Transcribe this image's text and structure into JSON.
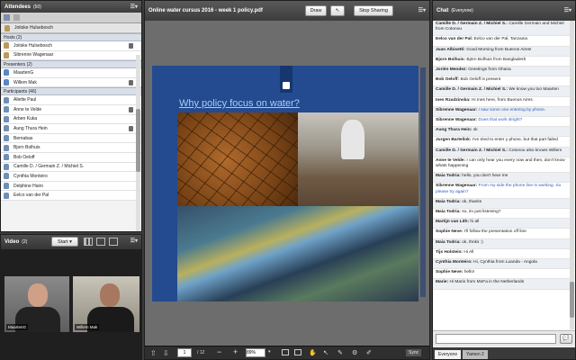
{
  "attendees": {
    "title": "Attendees",
    "count": "(50)",
    "current_user": "Joitske Hulsebosch",
    "hosts": {
      "label": "Hosts (2)",
      "items": [
        "Joitske Hulsebosch",
        "Sibrenne Wagenaar"
      ]
    },
    "presenters": {
      "label": "Presenters (2)",
      "items": [
        "MaartenG",
        "Willem Mak"
      ]
    },
    "participants": {
      "label": "Participants (46)",
      "items": [
        "Aliette Paul",
        "Anne te Velde",
        "Arben Kuka",
        "Aung Thura Hein",
        "Bernabas",
        "Bjorn Bolhuis",
        "Bob Oeloff",
        "Camille D. / Germain Z. / Michiel S.",
        "Cynthia Monteiro",
        "Delphine Hairo",
        "Eelco van der Pal"
      ]
    }
  },
  "video": {
    "title": "Video",
    "count": "(2)",
    "start_label": "Start",
    "tiles": [
      {
        "name": "MaartenG"
      },
      {
        "name": "Willem Mak"
      }
    ]
  },
  "share": {
    "title": "Online water cursus 2016 - week 1 policy.pdf",
    "draw_label": "Draw",
    "stop_label": "Stop Sharing",
    "slide_heading": "Why policy focus on water?",
    "page_value": "1",
    "page_total": "/ 12",
    "zoom_value": "89%",
    "sync_label": "Sync"
  },
  "chat": {
    "title": "Chat",
    "scope": "(Everyone)",
    "messages": [
      {
        "name": "Camille D. / Germain Z. / Michiel S.:",
        "text": "Camille Germain and Michiel from Cotonou",
        "style": "alt"
      },
      {
        "name": "Eelco van der Pal:",
        "text": "Eelco van der Pal, Tanzania",
        "style": ""
      },
      {
        "name": "Juan Albisetti:",
        "text": "Good Morning from Buenos Aires!",
        "style": "alt"
      },
      {
        "name": "Bjorn Bolhuis:",
        "text": "Björn Bolhuis from Bangladesh",
        "style": ""
      },
      {
        "name": "Jorién Mendez:",
        "text": "Greetings from Ghana",
        "style": "alt"
      },
      {
        "name": "Bob Oeloff:",
        "text": "Bob Oeloff is present",
        "style": ""
      },
      {
        "name": "Camille D. / Germain Z. / Michiel S.:",
        "text": "We know you too Maarten",
        "style": "alt"
      },
      {
        "name": "Ines Rzadzinska:",
        "text": "Hi Ines here, from Buenos Aires",
        "style": ""
      },
      {
        "name": "Sibrenne Wagenaar:",
        "text": "I saw some one entering by phone.",
        "style": "alt blue"
      },
      {
        "name": "Sibrenne Wagenaar:",
        "text": "Does that work slright?",
        "style": "blue"
      },
      {
        "name": "Aung Thura Hein:",
        "text": "ok",
        "style": "alt"
      },
      {
        "name": "Jurgen Bartelink:",
        "text": "I've tried to enter y phone, but that part failed",
        "style": ""
      },
      {
        "name": "Camille D. / Germain Z. / Michiel S.:",
        "text": "Cotonou also knows Willem",
        "style": "alt"
      },
      {
        "name": "Anne te Velde:",
        "text": "I can only hear you every now and then, don't know whats happening",
        "style": ""
      },
      {
        "name": "Maia Todria:",
        "text": "hello, you don't hear me",
        "style": "alt"
      },
      {
        "name": "Sibrenne Wagenaar:",
        "text": "From my side the phone line is working. So please try again?",
        "style": "blue"
      },
      {
        "name": "Maia Todria:",
        "text": "ok, thanks",
        "style": "alt"
      },
      {
        "name": "Maia Todria:",
        "text": "so, im just listening?",
        "style": ""
      },
      {
        "name": "Martijn van Lith:",
        "text": "hi all",
        "style": "alt"
      },
      {
        "name": "Sophie Neve:",
        "text": "I'll follow the presentation off line",
        "style": ""
      },
      {
        "name": "Maia Todria:",
        "text": "ok, thnks :)",
        "style": "alt"
      },
      {
        "name": "Tijs Holstein:",
        "text": "Hi All",
        "style": ""
      },
      {
        "name": "Cynthia Monteiro:",
        "text": "Hi, Cynthia from Luanda - Angola",
        "style": "alt"
      },
      {
        "name": "Sophie Neve:",
        "text": "hello!",
        "style": ""
      },
      {
        "name": "Marie:",
        "text": "Hi Mario from MoFa in the Netherlands",
        "style": "alt"
      }
    ],
    "tabs": [
      "Everyone",
      "Yamen 2"
    ]
  },
  "colors": {
    "accent": "#2b5aa8",
    "slide_title": "#a9cdf5",
    "blue_msg": "#2e5dbd"
  }
}
